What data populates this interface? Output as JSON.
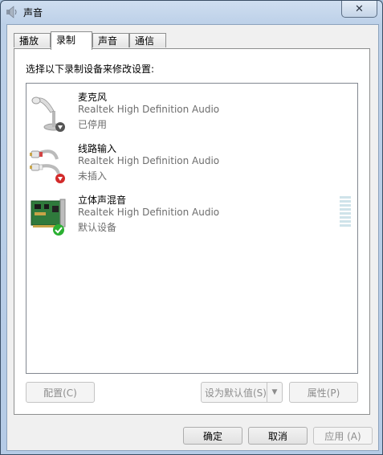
{
  "window": {
    "title": "声音",
    "close_glyph": "✕"
  },
  "tabs": [
    {
      "label": "播放",
      "active": false
    },
    {
      "label": "录制",
      "active": true
    },
    {
      "label": "声音",
      "active": false
    },
    {
      "label": "通信",
      "active": false
    }
  ],
  "panel": {
    "instruction": "选择以下录制设备来修改设置:"
  },
  "devices": [
    {
      "name": "麦克风",
      "driver": "Realtek High Definition Audio",
      "status": "已停用",
      "icon": "microphone-icon",
      "badge": "disabled-down-arrow"
    },
    {
      "name": "线路输入",
      "driver": "Realtek High Definition Audio",
      "status": "未插入",
      "icon": "line-in-cable-icon",
      "badge": "unplugged-red-arrow"
    },
    {
      "name": "立体声混音",
      "driver": "Realtek High Definition Audio",
      "status": "默认设备",
      "icon": "sound-card-icon",
      "badge": "default-green-check"
    }
  ],
  "panel_buttons": {
    "configure": "配置(C)",
    "set_default": "设为默认值(S)",
    "properties": "属性(P)"
  },
  "dialog_buttons": {
    "ok": "确定",
    "cancel": "取消",
    "apply": "应用 (A)"
  },
  "colors": {
    "accent_green": "#2bb032",
    "accent_red": "#d22a2a",
    "title_bar": "#bcd0e8"
  }
}
